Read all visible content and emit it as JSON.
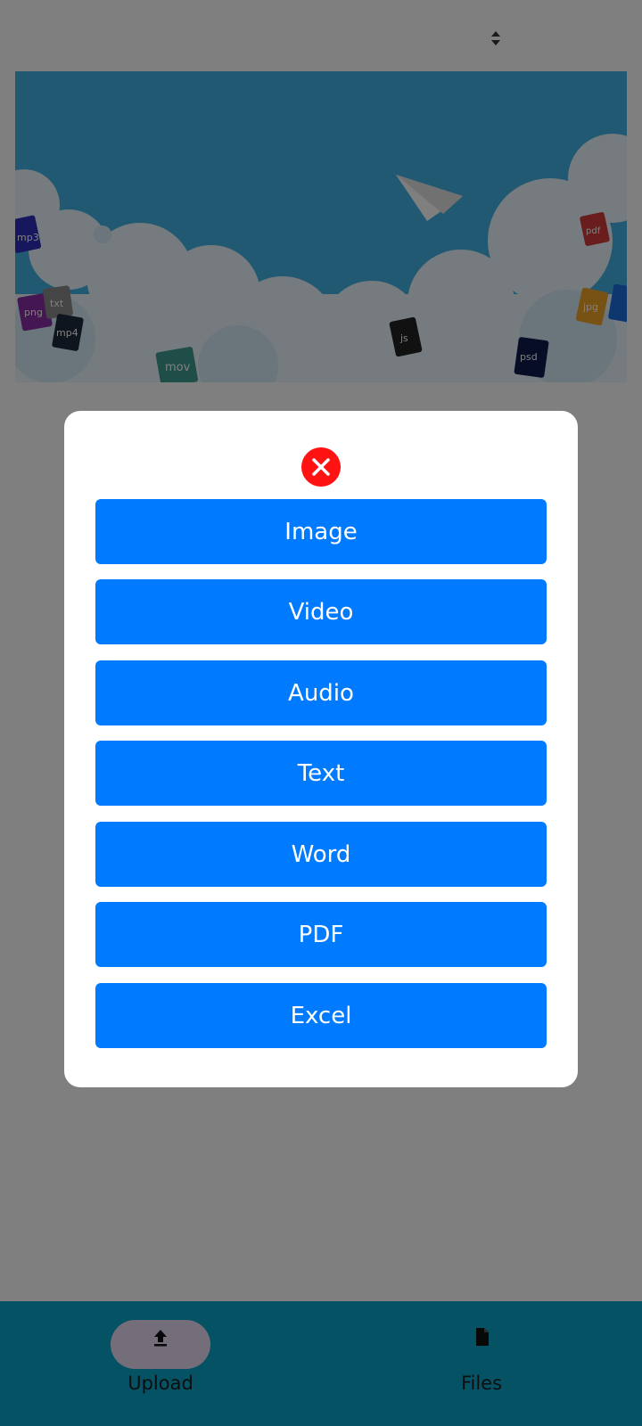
{
  "header": {
    "sort_icon": "sort-up-down-icon"
  },
  "banner": {
    "icon": "paper-plane-icon",
    "file_tags": [
      "mp3",
      "png",
      "txt",
      "mp4",
      "mov",
      "js",
      "psd",
      "pdf",
      "jpg"
    ]
  },
  "modal": {
    "close_icon": "close-circle-icon",
    "close_color": "#ff1212",
    "options": [
      "Image",
      "Video",
      "Audio",
      "Text",
      "Word",
      "PDF",
      "Excel"
    ],
    "button_color": "#007bff"
  },
  "bottom_nav": {
    "items": [
      {
        "label": "Upload",
        "icon": "upload-icon",
        "active": true
      },
      {
        "label": "Files",
        "icon": "file-icon",
        "active": false
      }
    ]
  }
}
